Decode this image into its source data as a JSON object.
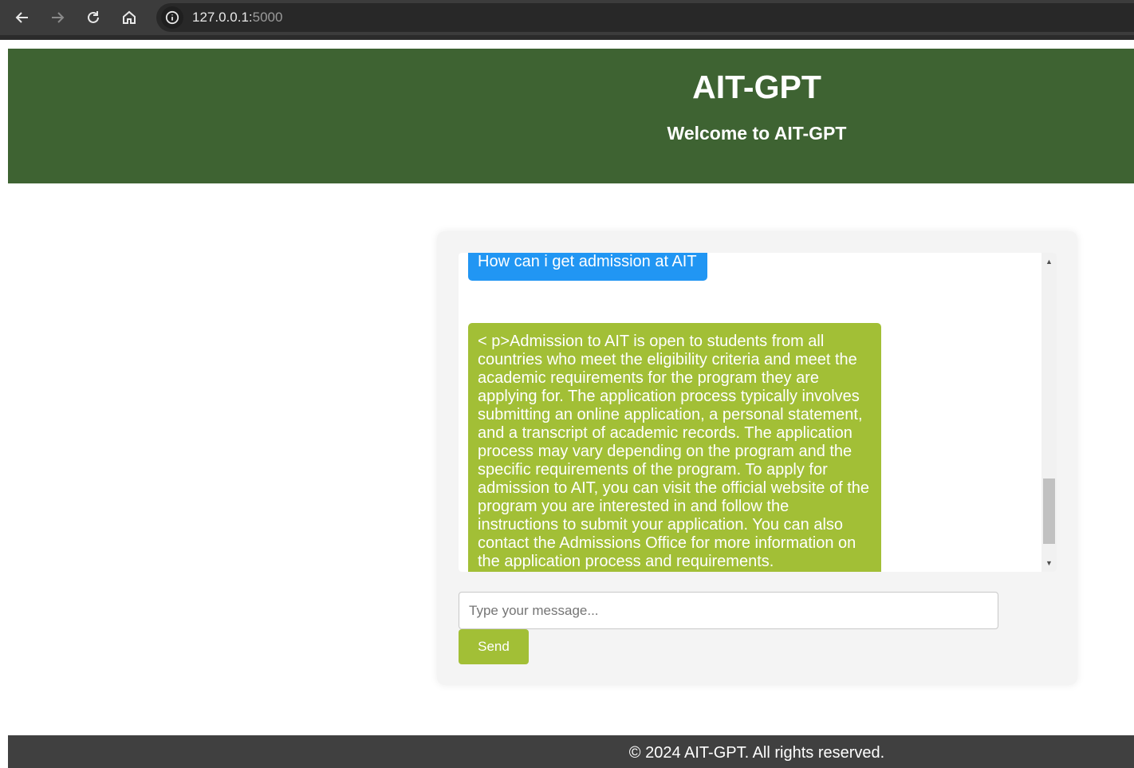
{
  "browser": {
    "url_host": "127.0.0.1:",
    "url_port": "5000",
    "icons": [
      "back-arrow-icon",
      "forward-arrow-icon",
      "reload-icon",
      "home-icon",
      "info-icon"
    ]
  },
  "header": {
    "title": "AIT-GPT",
    "subtitle": "Welcome to AIT-GPT"
  },
  "chat": {
    "messages": [
      {
        "role": "user",
        "text": "How can i get admission at AIT"
      },
      {
        "role": "bot",
        "text": "< p>Admission to AIT is open to students from all countries who meet the eligibility criteria and meet the academic requirements for the program they are applying for. The application process typically involves submitting an online application, a personal statement, and a transcript of academic records. The application process may vary depending on the program and the specific requirements of the program. To apply for admission to AIT, you can visit the official website of the program you are interested in and follow the instructions to submit your application. You can also contact the Admissions Office for more information on the application process and requirements."
      }
    ],
    "input_placeholder": "Type your message...",
    "input_value": "",
    "send_label": "Send"
  },
  "footer": {
    "text": "© 2024 AIT-GPT. All rights reserved."
  },
  "colors": {
    "header_bg": "#3e6332",
    "user_bubble": "#2196f3",
    "bot_bubble": "#a2bf36",
    "footer_bg": "#404040"
  }
}
